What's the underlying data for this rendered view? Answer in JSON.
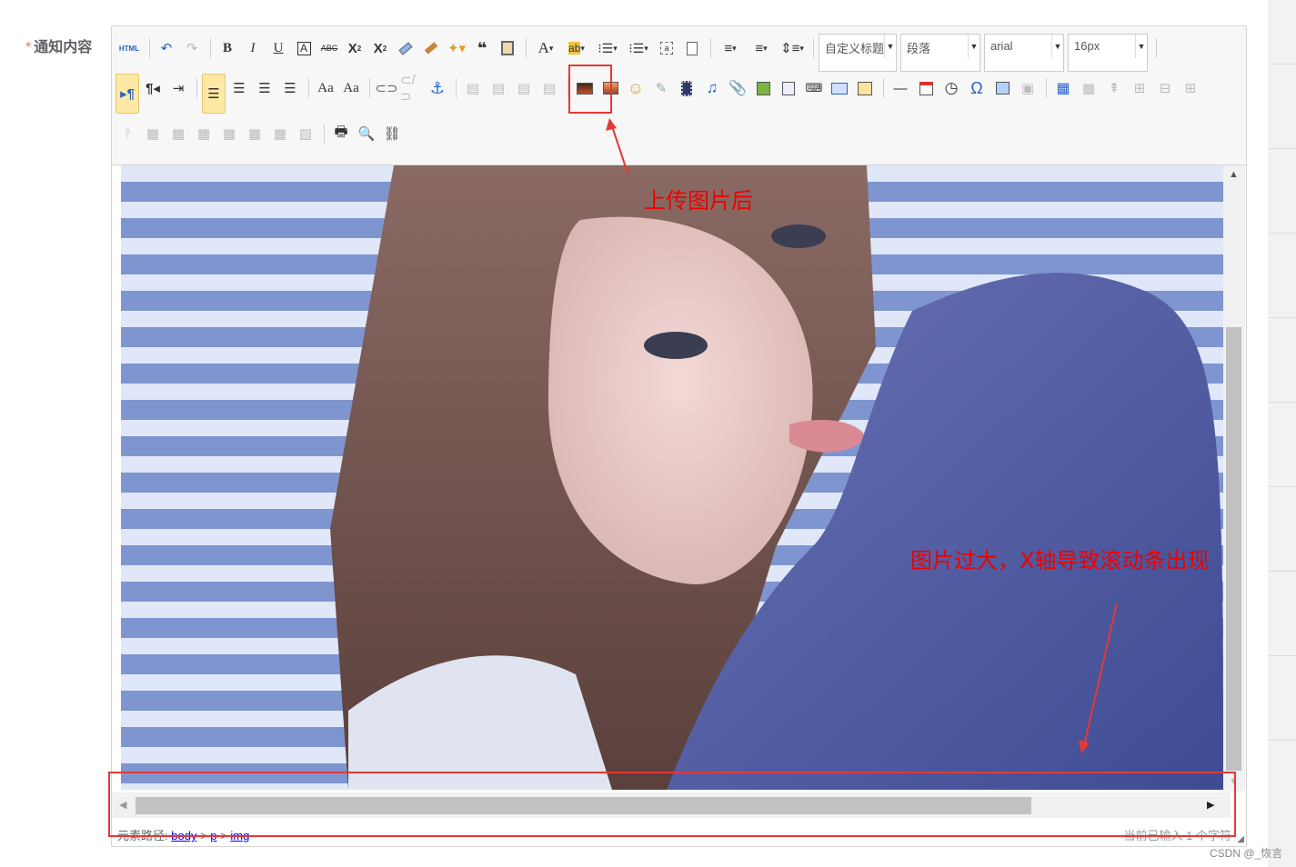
{
  "form": {
    "required_mark": "*",
    "label": "通知内容"
  },
  "toolbar": {
    "html_button": "HTML",
    "combos": {
      "custom_heading": "自定义标题",
      "paragraph": "段落",
      "font_family": "arial",
      "font_size": "16px"
    }
  },
  "statusbar": {
    "path_prefix": "元素路径:",
    "path_items": [
      "body",
      "p",
      "img"
    ],
    "path_sep": ">",
    "char_count": "当前已输入 1 个字符"
  },
  "annotations": {
    "upload_note": "上传图片后",
    "scroll_note": "图片过大，X轴导致滚动条出现"
  },
  "watermark": "CSDN @_恢言",
  "colors": {
    "annotation_red": "#e53935",
    "active_button": "#fde9a5",
    "toolbar_bg": "#f7f7f7"
  }
}
